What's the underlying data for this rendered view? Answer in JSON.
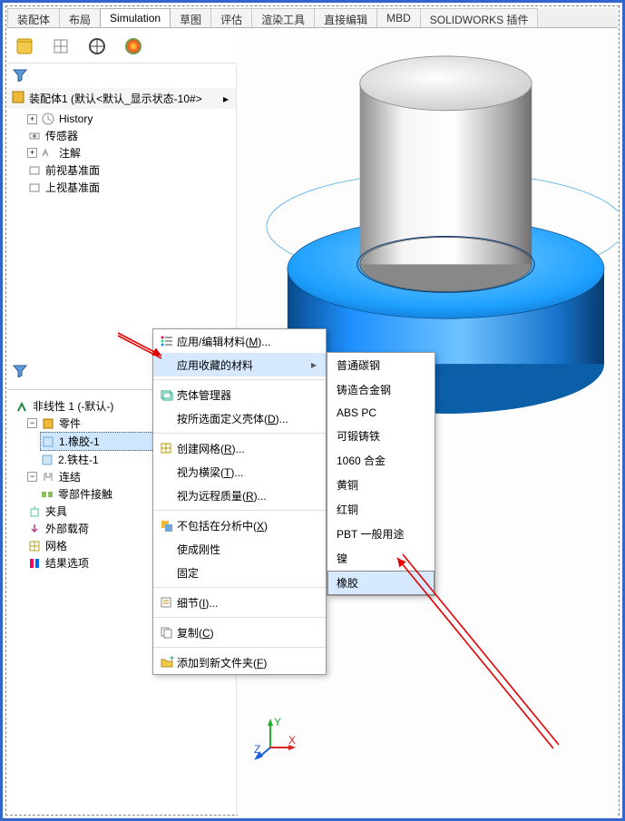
{
  "tabs": {
    "items": [
      "装配体",
      "布局",
      "Simulation",
      "草图",
      "评估",
      "渲染工具",
      "直接编辑",
      "MBD",
      "SOLIDWORKS 插件"
    ],
    "active_index": 2
  },
  "feature_tree": {
    "root": "装配体1 (默认<默认_显示状态-10#>",
    "history": "History",
    "sensors": "传感器",
    "annotations": "注解",
    "front_plane": "前视基准面",
    "top_plane": "上视基准面"
  },
  "sim_tree": {
    "study": "非线性 1 (-默认-)",
    "parts": "零件",
    "part_rubber": "1.橡胶-1",
    "part_steel": "2.铁柱-1",
    "connections": "连结",
    "component_contact": "零部件接触",
    "fixtures": "夹具",
    "loads": "外部载荷",
    "mesh": "网格",
    "results": "结果选项"
  },
  "context_menu": {
    "edit_material": "应用/编辑材料(M)...",
    "apply_fav": "应用收藏的材料",
    "shell_manager": "壳体管理器",
    "define_shell": "按所选面定义壳体(D)...",
    "create_mesh": "创建网格(R)...",
    "treat_beam": "视为横梁(T)...",
    "treat_remote": "视为远程质量(R)...",
    "exclude": "不包括在分析中(X)",
    "make_rigid": "使成刚性",
    "fix": "固定",
    "details": "细节(I)...",
    "copy": "复制(C)",
    "add_to_folder": "添加到新文件夹(F)"
  },
  "materials_submenu": {
    "items": [
      "普通碳钢",
      "铸造合金钢",
      "ABS PC",
      "可锻铸铁",
      "1060 合金",
      "黄铜",
      "红铜",
      "PBT 一般用途",
      "镍",
      "橡胶"
    ],
    "highlight_index": 9
  },
  "triad": {
    "x": "X",
    "y": "Y",
    "z": "Z"
  }
}
